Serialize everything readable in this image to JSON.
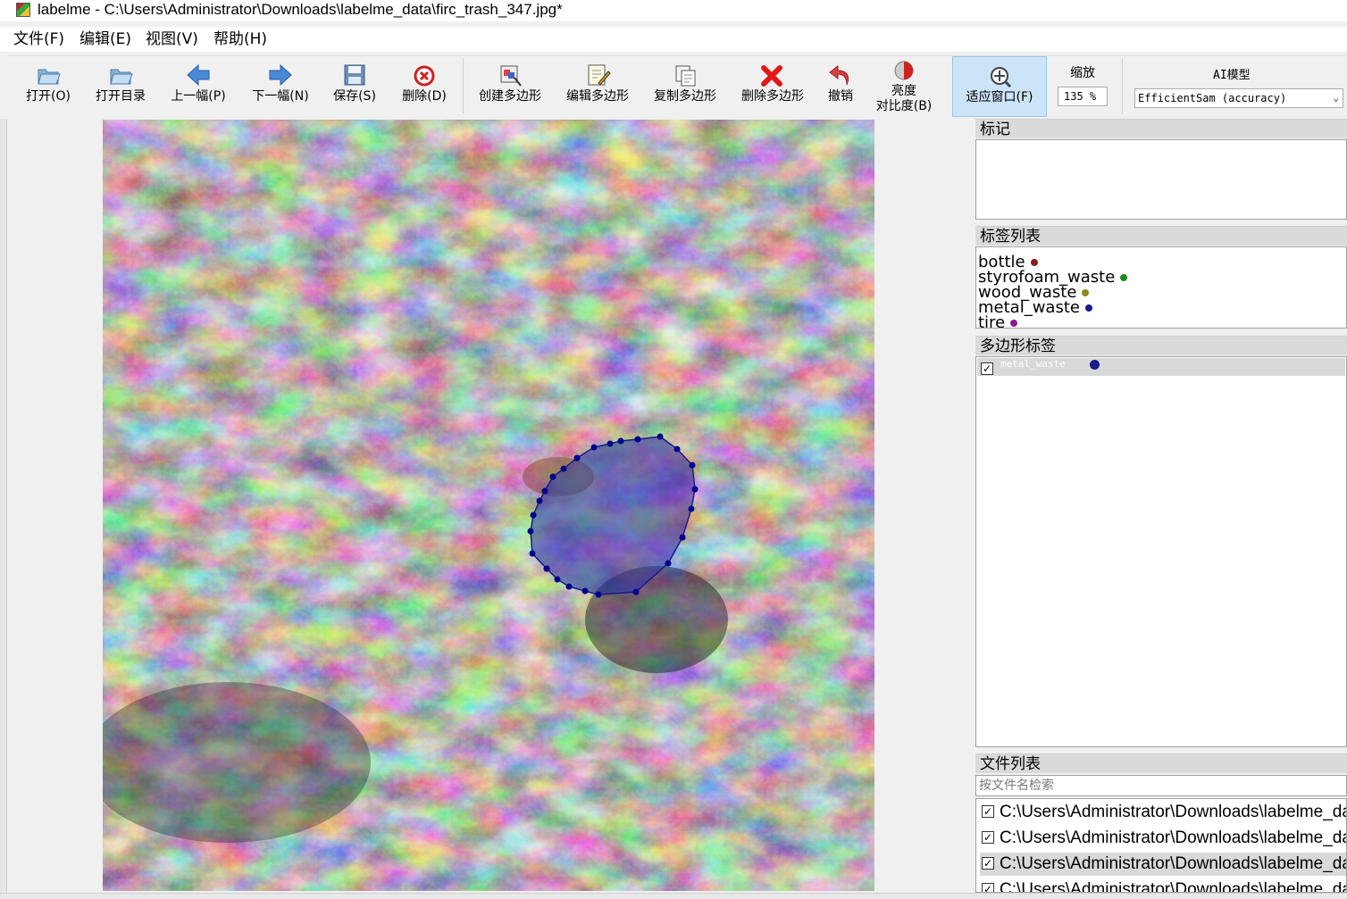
{
  "window": {
    "title": "labelme - C:\\Users\\Administrator\\Downloads\\labelme_data\\firc_trash_347.jpg*"
  },
  "menu": [
    "文件(F)",
    "编辑(E)",
    "视图(V)",
    "帮助(H)"
  ],
  "toolbar": {
    "open": "打开(O)",
    "open_dir": "打开目录",
    "prev": "上一幅(P)",
    "next": "下一幅(N)",
    "save": "保存(S)",
    "delete": "删除(D)",
    "create_polygon": "创建多边形",
    "edit_polygon": "编辑多边形",
    "copy_polygon": "复制多边形",
    "delete_polygon": "删除多边形",
    "undo": "撤销",
    "brightness_line1": "亮度",
    "brightness_line2": "对比度(B)",
    "fit_window": "适应窗口(F)",
    "zoom_label": "缩放",
    "zoom_value": "135 %",
    "ai_label": "AI模型",
    "ai_model": "EfficientSam (accuracy)"
  },
  "docks": {
    "flags_title": "标记",
    "label_list_title": "标签列表",
    "polygon_labels_title": "多边形标签",
    "file_list_title": "文件列表",
    "file_search_placeholder": "按文件名检索"
  },
  "labels": [
    {
      "name": "bottle",
      "color": "#8b1a1a"
    },
    {
      "name": "styrofoam_waste",
      "color": "#1a8b1a"
    },
    {
      "name": "wood_waste",
      "color": "#8b8b1a"
    },
    {
      "name": "metal_waste",
      "color": "#1a1a8b"
    },
    {
      "name": "tire",
      "color": "#8b1a8b"
    }
  ],
  "polygons": [
    {
      "label": "metal_waste",
      "color": "#1a1a8b",
      "checked": true
    }
  ],
  "files": [
    {
      "path": "C:\\Users\\Administrator\\Downloads\\labelme_data",
      "checked": true
    },
    {
      "path": "C:\\Users\\Administrator\\Downloads\\labelme_data",
      "checked": true
    },
    {
      "path": "C:\\Users\\Administrator\\Downloads\\labelme_data",
      "checked": true
    },
    {
      "path": "C:\\Users\\Administrator\\Downloads\\labelme_data",
      "checked": true
    }
  ],
  "colors": {
    "polygon_fill": "#3a3aa8",
    "polygon_stroke": "#00008b",
    "accent": "#cce4f7"
  }
}
